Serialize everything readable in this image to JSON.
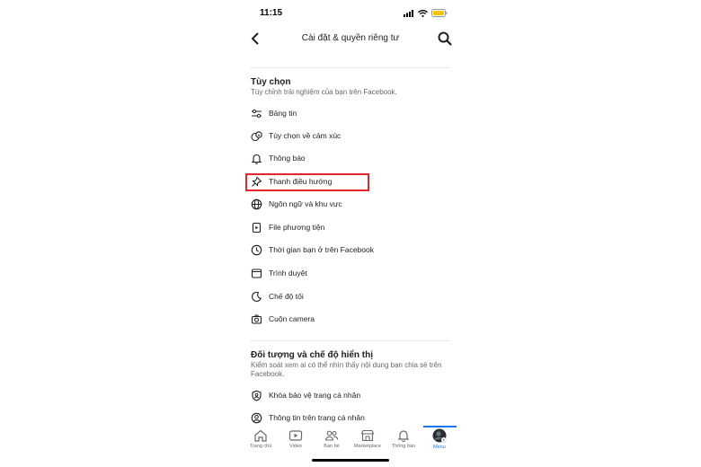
{
  "status": {
    "time": "11:15"
  },
  "header": {
    "title": "Cài đặt & quyền riêng tư"
  },
  "preferences": {
    "title": "Tùy chọn",
    "subtitle": "Tùy chỉnh trải nghiệm của bạn trên Facebook.",
    "items": [
      {
        "label": "Bảng tin",
        "icon": "sliders-icon"
      },
      {
        "label": "Tùy chọn về cảm xúc",
        "icon": "reactions-icon"
      },
      {
        "label": "Thông báo",
        "icon": "bell-icon"
      },
      {
        "label": "Thanh điều hướng",
        "icon": "pin-icon"
      },
      {
        "label": "Ngôn ngữ và khu vực",
        "icon": "globe-icon"
      },
      {
        "label": "File phương tiện",
        "icon": "media-file-icon"
      },
      {
        "label": "Thời gian bạn ở trên Facebook",
        "icon": "clock-icon"
      },
      {
        "label": "Trình duyệt",
        "icon": "browser-icon"
      },
      {
        "label": "Chế độ tối",
        "icon": "moon-icon"
      },
      {
        "label": "Cuộn camera",
        "icon": "camera-icon"
      }
    ]
  },
  "audience": {
    "title": "Đối tượng và chế độ hiển thị",
    "subtitle": "Kiểm soát xem ai có thể nhìn thấy nội dung bạn chia sẻ trên Facebook.",
    "items": [
      {
        "label": "Khóa bảo vệ trang cá nhân",
        "icon": "shield-user-icon"
      },
      {
        "label": "Thông tin trên trang cá nhân",
        "icon": "user-circle-icon"
      }
    ]
  },
  "tabs": [
    {
      "label": "Trang chủ",
      "icon": "home-icon"
    },
    {
      "label": "Video",
      "icon": "video-icon"
    },
    {
      "label": "Bạn bè",
      "icon": "friends-icon"
    },
    {
      "label": "Marketplace",
      "icon": "marketplace-icon"
    },
    {
      "label": "Thông báo",
      "icon": "bell-icon"
    },
    {
      "label": "Menu",
      "icon": "avatar-icon",
      "active": true
    }
  ],
  "colors": {
    "highlight": "#e0272a",
    "accent": "#1877f2"
  }
}
